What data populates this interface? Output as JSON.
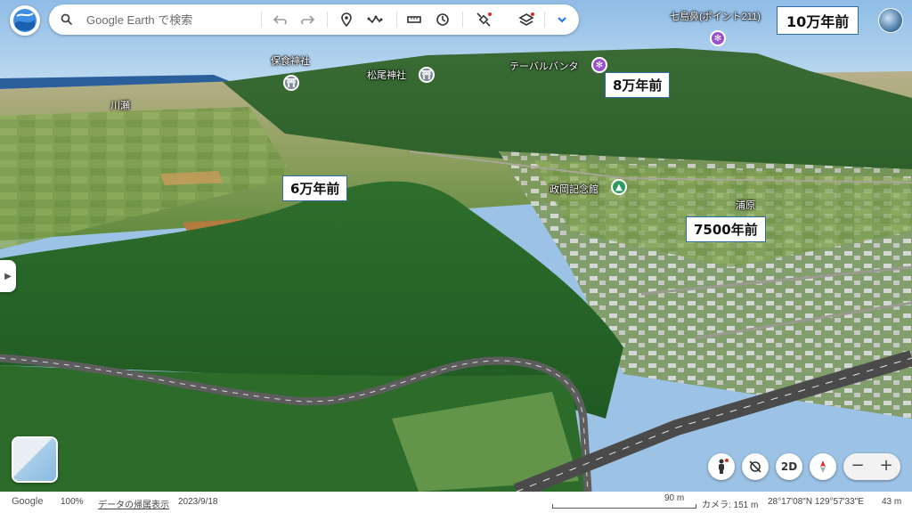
{
  "search": {
    "placeholder": "Google Earth で検索"
  },
  "toolbar": {
    "icons": [
      "undo-icon",
      "redo-icon",
      "location-pin-icon",
      "path-icon",
      "ruler-icon",
      "history-icon",
      "satellite-icon",
      "layers-icon",
      "chevron-down-icon"
    ]
  },
  "header": {
    "point_name": "七島鼻(ポイント211)",
    "annotation_top": "10万年前"
  },
  "map_labels": {
    "hoshoku": "保食神社",
    "matsuo": "松尾神社",
    "table": "テーバルバンタ",
    "kawasemi": "川瀬",
    "seikou": "政岡記念館",
    "urahara": "浦原"
  },
  "annotations": {
    "a8": "8万年前",
    "a6": "6万年前",
    "a7500": "7500年前"
  },
  "controls": {
    "mode_2d": "2D",
    "zoom_out": "−",
    "zoom_in": "+"
  },
  "footer": {
    "google": "Google",
    "zoom_level": "100%",
    "data_link": "データの帰属表示",
    "date": "2023/9/18",
    "scale": "90 m",
    "camera": "カメラ: 151 m",
    "coords": "28°17'08\"N 129°57'33\"E",
    "elevation": "43 m"
  },
  "colors": {
    "pin_purple": "#9a4fd1",
    "pin_green": "#2e9b5e",
    "pin_gray": "#7d8b96",
    "annotation_border": "#2d6ea7"
  }
}
